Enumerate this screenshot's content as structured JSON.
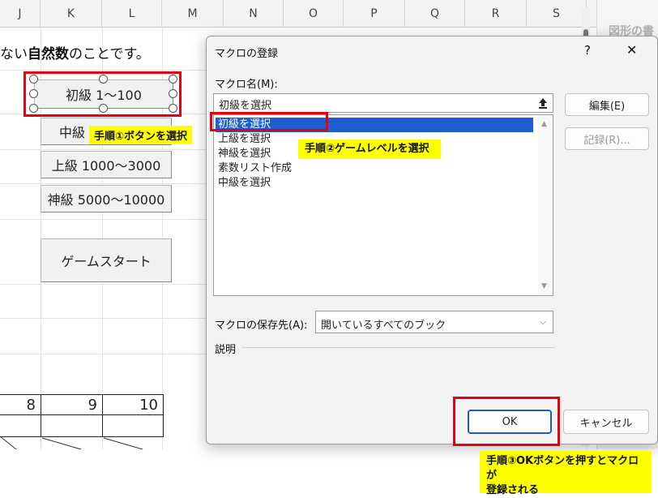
{
  "sheet": {
    "columns": [
      "J",
      "K",
      "L",
      "M",
      "N",
      "O",
      "P",
      "Q",
      "R",
      "S"
    ],
    "sentence_prefix": "ない",
    "sentence_bold": "自然数",
    "sentence_suffix": "のことです。",
    "buttons": {
      "beginner": "初級  1〜100",
      "intermediate": "中級",
      "advanced": "上級  1000〜3000",
      "god": "神級  5000〜10000",
      "start": "ゲームスタート"
    },
    "table_header": [
      "8",
      "9",
      "10"
    ],
    "right_panel_text": "図形の書"
  },
  "callouts": {
    "step1": "手順①ボタンを選択",
    "step2": "手順②ゲームレベルを選択",
    "step3_line1": "手順③OKボタンを押すとマクロが",
    "step3_line2": "登録される"
  },
  "dialog": {
    "title": "マクロの登録",
    "help": "?",
    "close": "✕",
    "macro_name_label": "マクロ名(M):",
    "macro_name_value": "初級を選択",
    "macro_list": [
      "初級を選択",
      "上級を選択",
      "神級を選択",
      "素数リスト作成",
      "中級を選択"
    ],
    "edit_button": "編集(E)",
    "record_button": "記録(R)...",
    "location_label": "マクロの保存先(A):",
    "location_value": "開いているすべてのブック",
    "description_label": "説明",
    "ok_button": "OK",
    "cancel_button": "キャンセル"
  }
}
